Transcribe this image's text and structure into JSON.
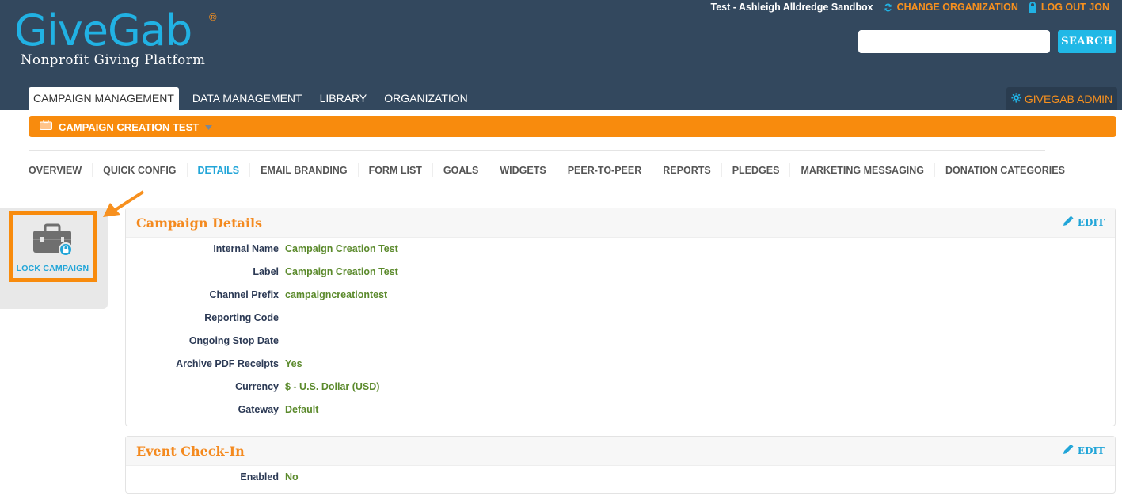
{
  "header": {
    "logo_text": "GiveGab",
    "logo_reg": "®",
    "logo_tagline": "Nonprofit Giving Platform",
    "user_label": "Test - Ashleigh Alldredge Sandbox",
    "change_org_label": "CHANGE ORGANIZATION",
    "logout_label": "LOG OUT JON",
    "search": {
      "value": "",
      "placeholder": "",
      "button_label": "SEARCH"
    },
    "nav_tabs": [
      "CAMPAIGN MANAGEMENT",
      "DATA MANAGEMENT",
      "LIBRARY",
      "ORGANIZATION"
    ],
    "admin_label": "GIVEGAB ADMIN"
  },
  "campaign_bar": {
    "name": "CAMPAIGN CREATION TEST"
  },
  "subnav": [
    "OVERVIEW",
    "QUICK CONFIG",
    "DETAILS",
    "EMAIL BRANDING",
    "FORM LIST",
    "GOALS",
    "WIDGETS",
    "PEER-TO-PEER",
    "REPORTS",
    "PLEDGES",
    "MARKETING MESSAGING",
    "DONATION CATEGORIES"
  ],
  "subnav_active": "DETAILS",
  "sidebar": {
    "lock_label": "LOCK CAMPAIGN"
  },
  "campaign_details": {
    "title": "Campaign Details",
    "edit_label": "EDIT",
    "fields": [
      {
        "label": "Internal Name",
        "value": "Campaign Creation Test"
      },
      {
        "label": "Label",
        "value": "Campaign Creation Test"
      },
      {
        "label": "Channel Prefix",
        "value": "campaigncreationtest"
      },
      {
        "label": "Reporting Code",
        "value": ""
      },
      {
        "label": "Ongoing Stop Date",
        "value": ""
      },
      {
        "label": "Archive PDF Receipts",
        "value": "Yes"
      },
      {
        "label": "Currency",
        "value": "$ - U.S. Dollar (USD)"
      },
      {
        "label": "Gateway",
        "value": "Default"
      }
    ]
  },
  "event_checkin": {
    "title": "Event Check-In",
    "edit_label": "EDIT",
    "fields": [
      {
        "label": "Enabled",
        "value": "No"
      }
    ]
  },
  "colors": {
    "header_bg": "#33485e",
    "brand_blue": "#21b2e4",
    "brand_orange": "#f88b0d",
    "value_green": "#5b8a2c",
    "label_navy": "#2c3a55"
  },
  "icons": {
    "change_org": "refresh-icon",
    "logout": "lock-icon",
    "admin": "gear-icon",
    "campaign": "briefcase-icon",
    "dropdown": "caret-down-icon",
    "edit": "pencil-icon",
    "lock_campaign": "briefcase-lock-icon",
    "callout": "arrow-icon"
  }
}
